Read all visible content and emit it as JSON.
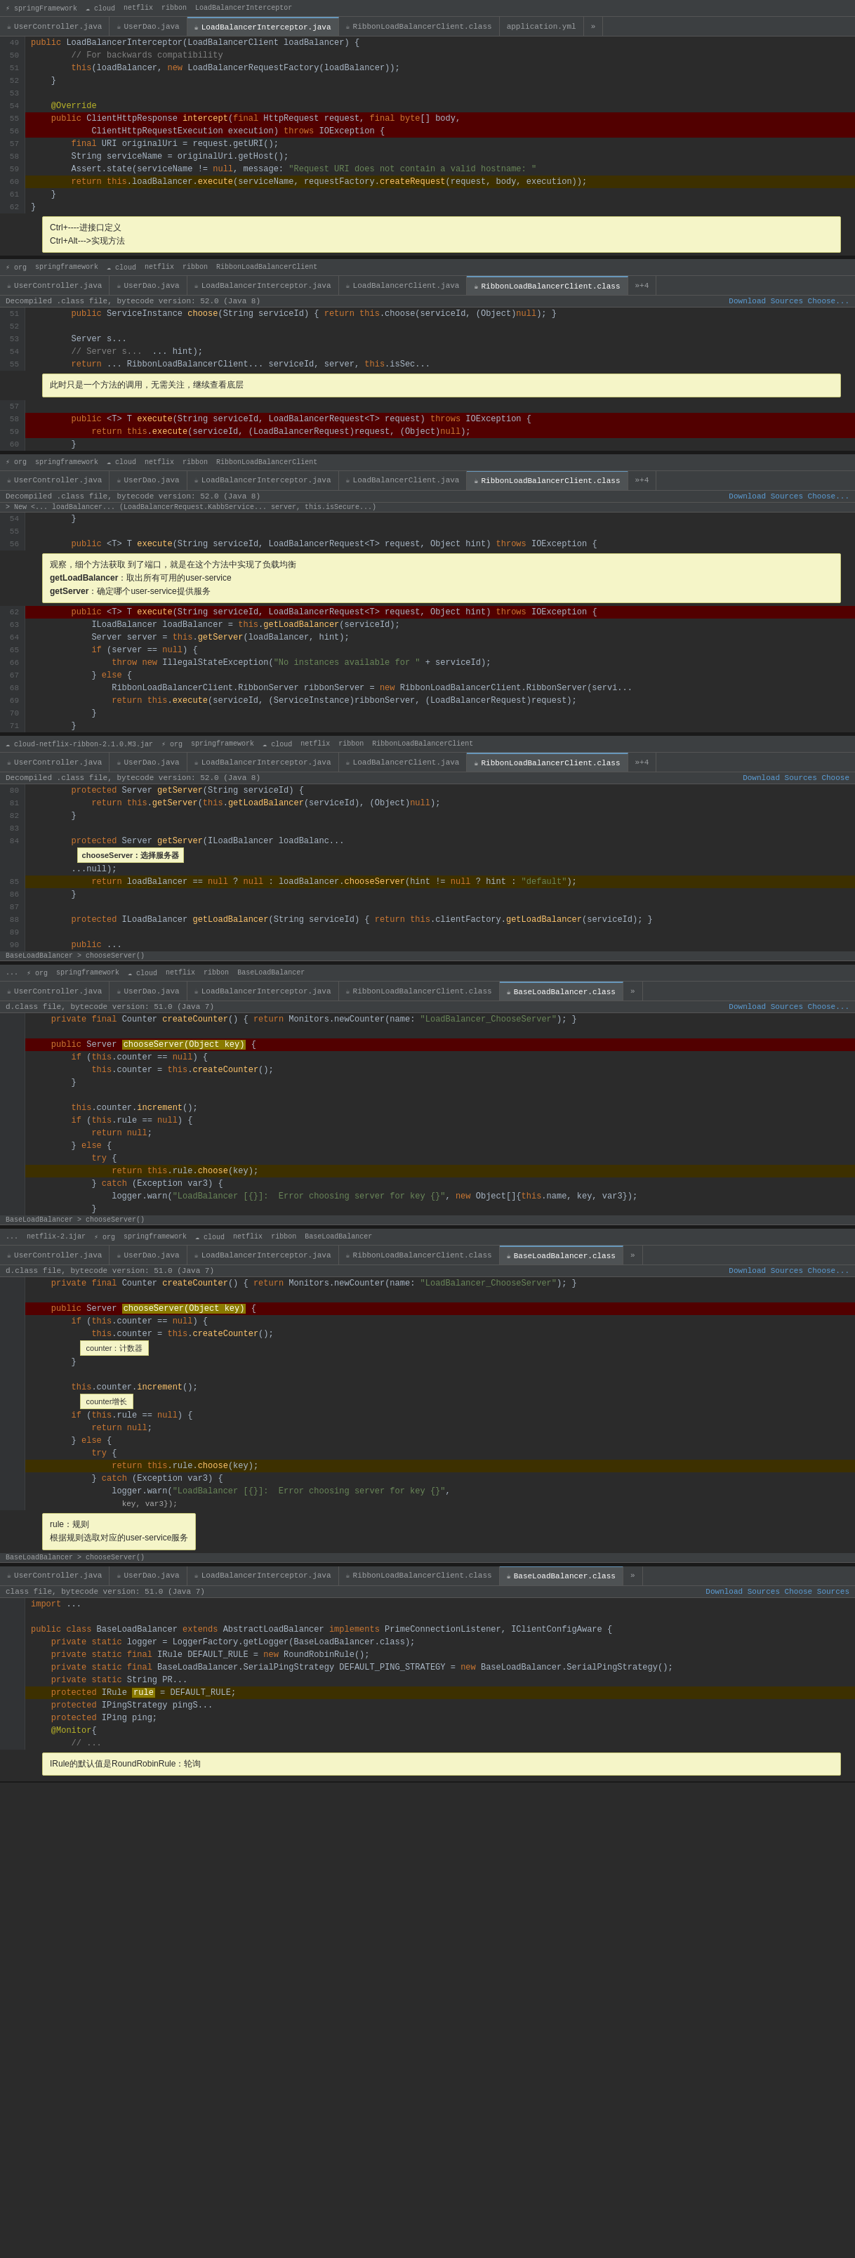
{
  "sections": [
    {
      "id": "section1",
      "tabs": [
        {
          "label": "springFramework",
          "active": false
        },
        {
          "label": "cloud",
          "active": false
        },
        {
          "label": "netflix",
          "active": false
        },
        {
          "label": "ribbon",
          "active": false
        },
        {
          "label": "LoadBalancerInterceptor.java",
          "active": true
        },
        {
          "label": "RibbonLoadBalancerClient.class",
          "active": false
        },
        {
          "label": "application.yml",
          "active": false
        }
      ],
      "status": "Decompiled .class file, bytecode version: 52.0 (Java 8)",
      "download": "Download Sources  Choose...",
      "breadcrumb": "",
      "lines": []
    }
  ],
  "ui": {
    "section1_title": "LoadBalancerInterceptor.java",
    "section2_title": "RibbonLoadBalancerClient.class",
    "section3_title": "RibbonLoadBalancerClient.class",
    "section4_title": "BaseLoadBalancer.class",
    "section5_title": "BaseLoadBalancer.class",
    "section6_title": "BaseLoadBalancer.class"
  },
  "annotations": {
    "ctrl_hint": "Ctrl+----进接口定义\nCtrl+Alt--->实现方法",
    "method_only": "此时只是一个方法的调用，无需关注，继续查看底层",
    "observe_hint": "观察，细个方法获取 到了端口，就是在这个方法中实现了负载均衡\ngetLoadBalancer：取出所有可用的user-service\ngetServer：确定哪个user-service提供服务",
    "chooseServer": "chooseServer：选择服务器",
    "counter_hint": "counter：计数器",
    "counter_incr": "counter增长",
    "rule_hint": "rule：规则\n根据规则选取对应的user-service服务",
    "iRule_hint": "IRule的默认值是RoundRobinRule：轮询"
  }
}
